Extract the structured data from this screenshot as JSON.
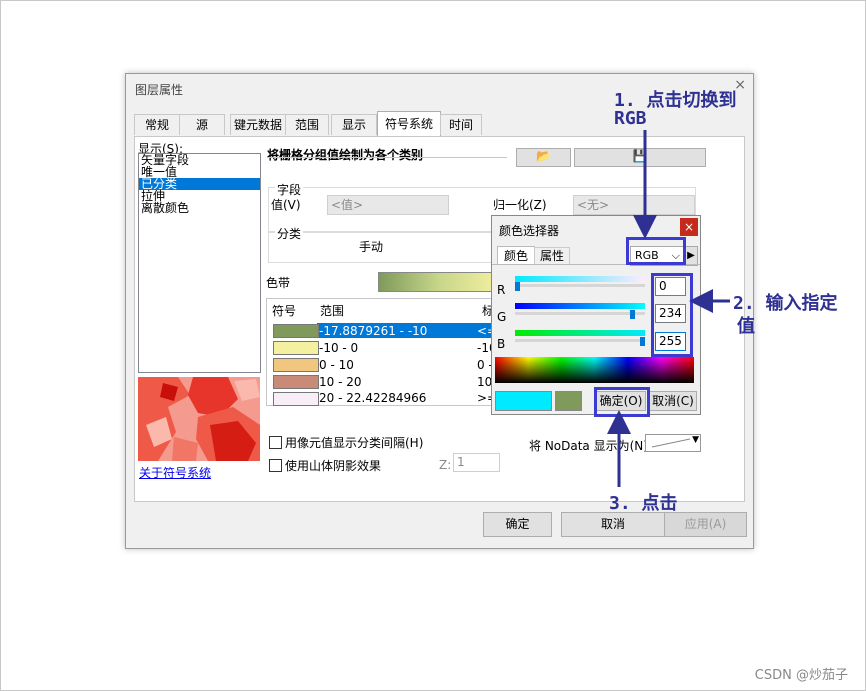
{
  "dialog": {
    "title": "图层属性",
    "close_glyph": "×",
    "tabs": [
      "常规",
      "源",
      "键元数据",
      "范围",
      "显示",
      "符号系统",
      "时间"
    ],
    "active_tab": "符号系统",
    "show_label": "显示(S):",
    "show_items": [
      "矢量字段",
      "唯一值",
      "已分类",
      "拉伸",
      "离散颜色"
    ],
    "selected_show": "已分类",
    "heading": "将栅格分组值绘制为各个类别",
    "field_group": "字段",
    "value_label": "值(V)",
    "value_combo": "<值>",
    "normalize_label": "归一化(Z)",
    "normalize_combo": "<无>",
    "class_group": "分类",
    "class_method": "手动",
    "colorband_label": "色带",
    "table_headers": [
      "符号",
      "范围",
      "标"
    ],
    "rows": [
      {
        "color": "#7f9a5b",
        "range": "-17.8879261 - -10",
        "label": "<="
      },
      {
        "color": "#f3f0a0",
        "range": "-10 - 0",
        "label": "-10"
      },
      {
        "color": "#f1c67f",
        "range": "0 - 10",
        "label": "0 -"
      },
      {
        "color": "#c98a78",
        "range": "10 - 20",
        "label": "10"
      },
      {
        "color": "#f8eef8",
        "range": "20 - 22.42284966",
        "label": ">="
      }
    ],
    "about_link": "关于符号系统",
    "checkbox_gap": "用像元值显示分类间隔(H)",
    "checkbox_hillshade": "使用山体阴影效果",
    "z_label": "Z:",
    "z_value": "1",
    "nodata_label": "将 NoData 显示为(N)",
    "buttons": {
      "ok": "确定",
      "cancel": "取消",
      "apply": "应用(A)"
    }
  },
  "color_picker": {
    "title": "颜色选择器",
    "close_glyph": "×",
    "tabs": [
      "颜色",
      "属性"
    ],
    "mode": "RGB",
    "channels": [
      {
        "name": "R",
        "value": "0",
        "fraction": 0.0
      },
      {
        "name": "G",
        "value": "234",
        "fraction": 0.918
      },
      {
        "name": "B",
        "value": "255",
        "fraction": 1.0
      }
    ],
    "new_color": "#00eaff",
    "old_color": "#7f9a5b",
    "ok": "确定(O)",
    "cancel": "取消(C)"
  },
  "annotations": {
    "step1_line1": "1. 点击切换到",
    "step1_line2": "RGB",
    "step2_line1": "2. 输入指定",
    "step2_line2": "值",
    "step3": "3. 点击"
  },
  "watermark": "CSDN @炒茄子",
  "colors": {
    "annotation": "#2e3192",
    "highlight": "#3b3bd1",
    "selection": "#0078d7"
  }
}
